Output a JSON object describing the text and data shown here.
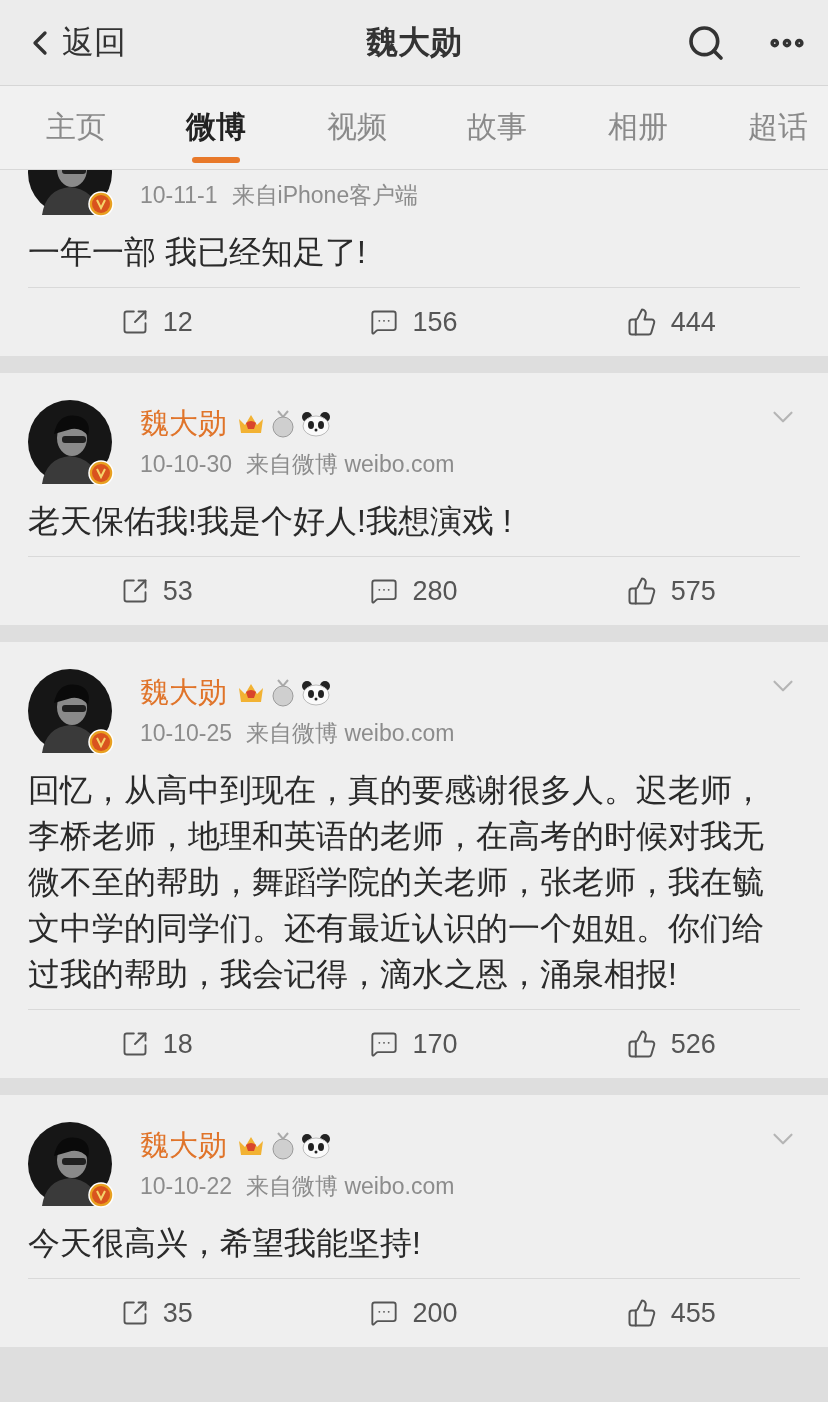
{
  "nav": {
    "back": "返回",
    "title": "魏大勋"
  },
  "tabs": [
    {
      "label": "主页",
      "selected": false
    },
    {
      "label": "微博",
      "selected": true
    },
    {
      "label": "视频",
      "selected": false
    },
    {
      "label": "故事",
      "selected": false
    },
    {
      "label": "相册",
      "selected": false
    },
    {
      "label": "超话",
      "selected": false
    }
  ],
  "posts": [
    {
      "time": "10-11-1",
      "source": "来自iPhone客户端",
      "text": "一年一部 我已经知足了!",
      "reposts": "12",
      "comments": "156",
      "likes": "444"
    },
    {
      "name": "魏大勋",
      "time": "10-10-30",
      "source": "来自微博 weibo.com",
      "text": "老天保佑我!我是个好人!我想演戏 !",
      "reposts": "53",
      "comments": "280",
      "likes": "575"
    },
    {
      "name": "魏大勋",
      "time": "10-10-25",
      "source": "来自微博 weibo.com",
      "text": "回忆，从高中到现在，真的要感谢很多人。迟老师，李桥老师，地理和英语的老师，在高考的时候对我无微不至的帮助，舞蹈学院的关老师，张老师，我在毓文中学的同学们。还有最近认识的一个姐姐。你们给过我的帮助，我会记得，滴水之恩，涌泉相报!",
      "reposts": "18",
      "comments": "170",
      "likes": "526"
    },
    {
      "name": "魏大勋",
      "time": "10-10-22",
      "source": "来自微博 weibo.com",
      "text": "今天很高兴，希望我能坚持!",
      "reposts": "35",
      "comments": "200",
      "likes": "455"
    }
  ]
}
